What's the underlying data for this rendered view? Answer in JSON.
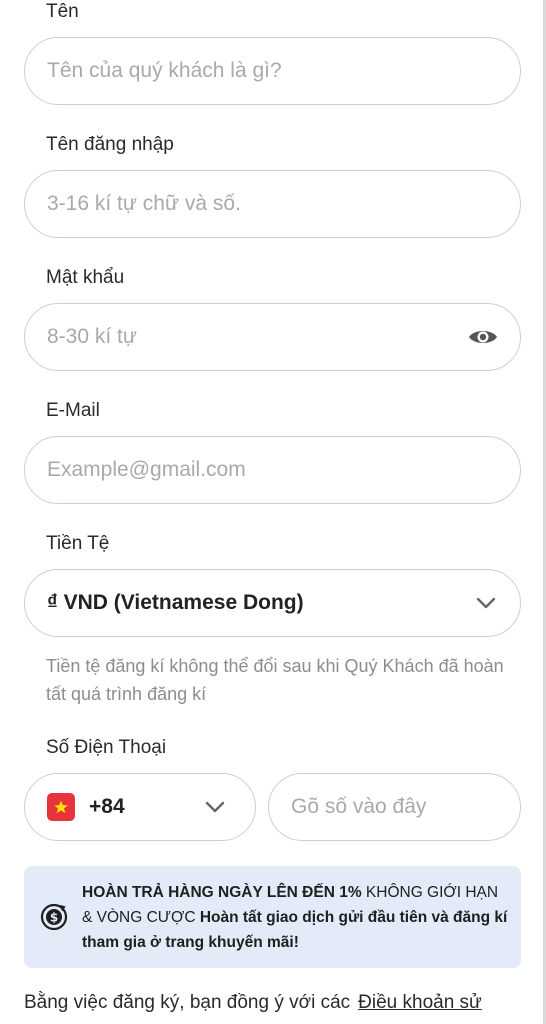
{
  "form": {
    "name": {
      "label": "Tên",
      "placeholder": "Tên của quý khách là gì?"
    },
    "username": {
      "label": "Tên đăng nhập",
      "placeholder": "3-16 kí tự chữ và số."
    },
    "password": {
      "label": "Mật khẩu",
      "placeholder": "8-30 kí tự"
    },
    "email": {
      "label": "E-Mail",
      "placeholder": "Example@gmail.com"
    },
    "currency": {
      "label": "Tiền Tệ",
      "value": "₫ VND (Vietnamese Dong)",
      "hint": "Tiền tệ đăng kí không thể đổi sau khi Quý Khách đã hoàn tất quá trình đăng kí"
    },
    "phone": {
      "label": "Số Điện Thoại",
      "country_code": "+84",
      "placeholder": "Gõ số vào đây"
    }
  },
  "promo": {
    "part1": "HOÀN TRẢ HÀNG NGÀY LÊN ĐẾN 1%",
    "part2": " KHÔNG GIỚI HẠN & VÒNG CƯỢC ",
    "part3": "Hoàn tất giao dịch gửi đầu tiên và đăng kí tham gia ở trang khuyến mãi!"
  },
  "footer": {
    "text": "Bằng việc đăng ký, bạn đồng ý với các",
    "link": "Điều khoản sử"
  },
  "colors": {
    "border": "#cfcfcf",
    "placeholder": "#a9a9a9",
    "promo_bg": "#e2ebf7",
    "flag_red": "#e8323c"
  },
  "icons": {
    "password_toggle": "eye-icon",
    "dropdown": "chevron-down-icon",
    "flag": "vietnam-flag-icon",
    "promo": "cashback-icon"
  }
}
